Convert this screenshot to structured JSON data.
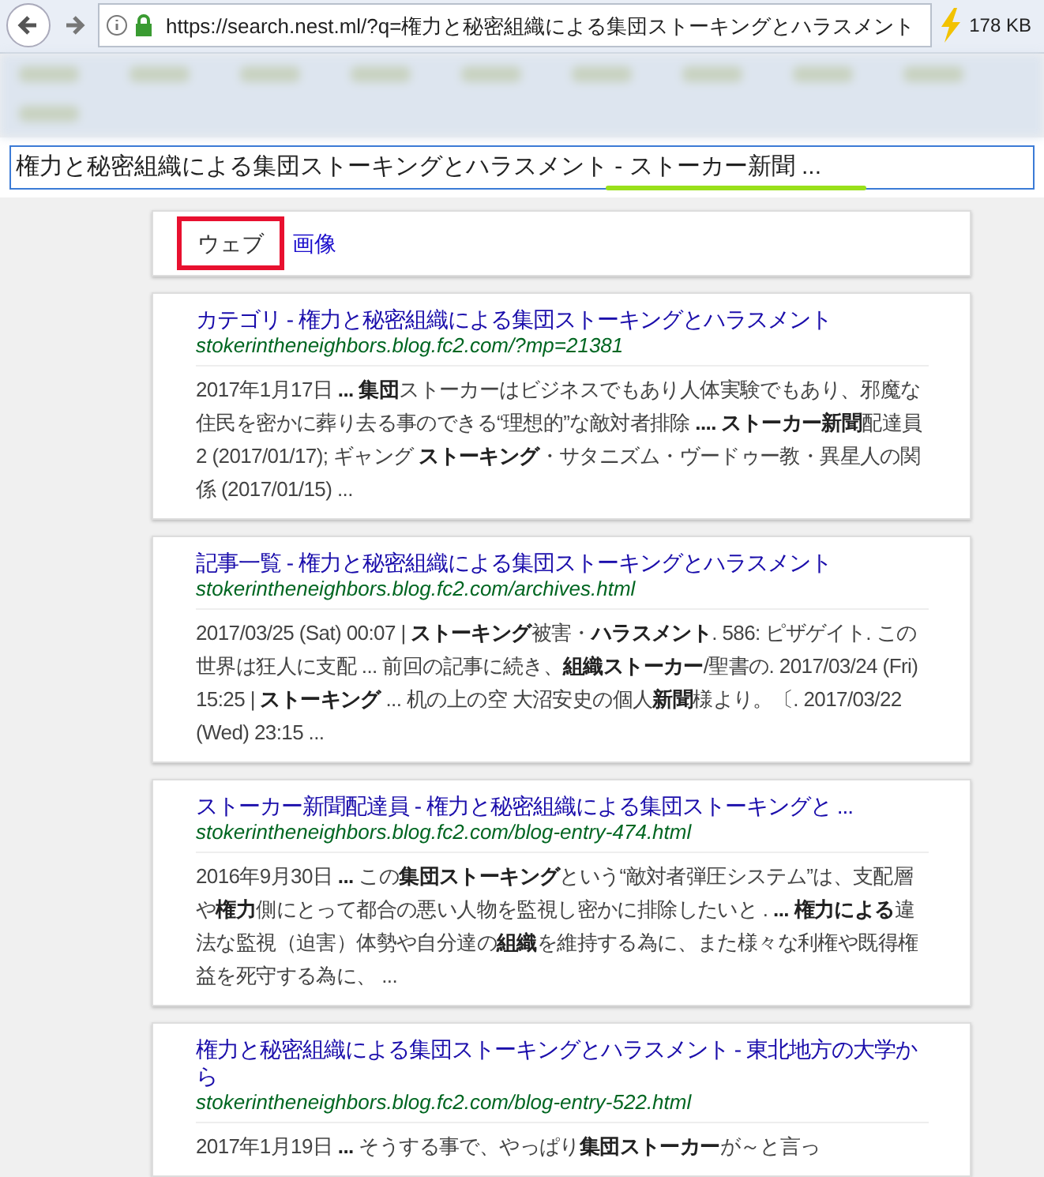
{
  "browser": {
    "url": "https://search.nest.ml/?q=権力と秘密組織による集団ストーキングとハラスメント",
    "data_size": "178 KB"
  },
  "search": {
    "value": "権力と秘密組織による集団ストーキングとハラスメント - ストーカー新聞 ..."
  },
  "tabs": [
    {
      "label": "ウェブ",
      "selected": true
    },
    {
      "label": "画像",
      "selected": false
    }
  ],
  "results": [
    {
      "title": "カテゴリ - 権力と秘密組織による集団ストーキングとハラスメント",
      "url": "stokerintheneighbors.blog.fc2.com/?mp=21381",
      "snippet": "2017年1月17日 **...** **集団**ストーカーはビジネスでもあり人体実験でもあり、邪魔な住民を密かに葬り去る事のできる“理想的”な敵対者排除 **....** **ストーカー新聞**配達員 2 (2017/01/17); ギャング **ストーキング**・サタニズム・ヴードゥー教・異星人の関係 (2017/01/15) ..."
    },
    {
      "title": "記事一覧 - 権力と秘密組織による集団ストーキングとハラスメント",
      "url": "stokerintheneighbors.blog.fc2.com/archives.html",
      "snippet": "2017/03/25 (Sat) 00:07 | **ストーキング**被害・**ハラスメント**. 586: ピザゲイト. この世界は狂人に支配 ... 前回の記事に続き、**組織ストーカー**/聖書の. 2017/03/24 (Fri) 15:25 | **ストーキング** ... 机の上の空 大沼安史の個人**新聞**様より。〔. 2017/03/22 (Wed) 23:15 ..."
    },
    {
      "title": "ストーカー新聞配達員 - 権力と秘密組織による集団ストーキングと ...",
      "url": "stokerintheneighbors.blog.fc2.com/blog-entry-474.html",
      "snippet": "2016年9月30日 **...** この**集団ストーキング**という“敵対者弾圧システム”は、支配層や**権力**側にとって都合の悪い人物を監視し密かに排除したいと . **...** **権力による**違法な監視（迫害）体勢や自分達の**組織**を維持する為に、また様々な利権や既得権益を死守する為に、 ..."
    },
    {
      "title": "権力と秘密組織による集団ストーキングとハラスメント - 東北地方の大学から",
      "url": "stokerintheneighbors.blog.fc2.com/blog-entry-522.html",
      "snippet": "2017年1月19日 **...** そうする事で、やっぱり**集団ストーカー**が～と言っ"
    }
  ]
}
